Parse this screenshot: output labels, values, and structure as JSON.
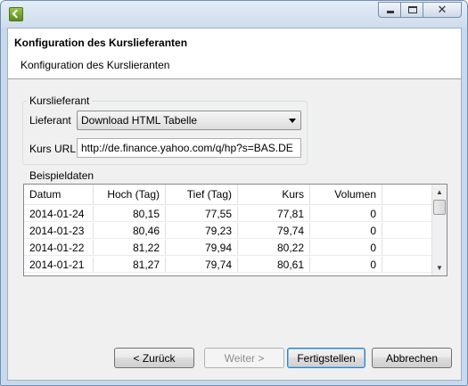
{
  "window": {
    "app_icon": "eclipse-app-icon",
    "controls": {
      "minimize": "minimize-icon",
      "maximize": "maximize-icon",
      "close": "close-icon"
    }
  },
  "banner": {
    "title": "Konfiguration des Kurslieferanten",
    "subtitle": "Konfiguration des Kurslieranten"
  },
  "provider_group": {
    "label": "Kurslieferant",
    "lieferant_label": "Lieferant",
    "lieferant_value": "Download HTML Tabelle",
    "url_label": "Kurs URL",
    "url_value": "http://de.finance.yahoo.com/q/hp?s=BAS.DE"
  },
  "sample_group": {
    "label": "Beispieldaten",
    "columns": [
      "Datum",
      "Hoch (Tag)",
      "Tief (Tag)",
      "Kurs",
      "Volumen"
    ],
    "rows": [
      [
        "2014-01-24",
        "80,15",
        "77,55",
        "77,81",
        "0"
      ],
      [
        "2014-01-23",
        "80,46",
        "79,23",
        "79,74",
        "0"
      ],
      [
        "2014-01-22",
        "81,22",
        "79,94",
        "80,22",
        "0"
      ],
      [
        "2014-01-21",
        "81,27",
        "79,74",
        "80,61",
        "0"
      ]
    ]
  },
  "buttons": {
    "back": "< Zurück",
    "next": "Weiter >",
    "finish": "Fertigstellen",
    "cancel": "Abbrechen"
  }
}
